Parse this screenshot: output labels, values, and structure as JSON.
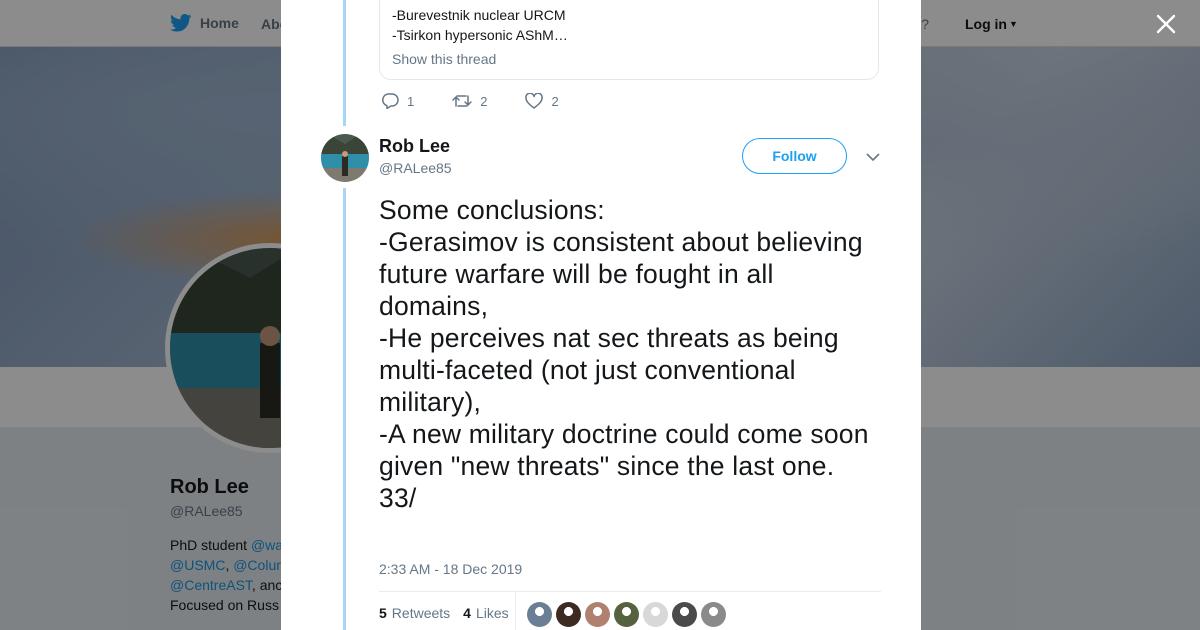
{
  "topnav": {
    "home_label": "Home",
    "about_label": "Abo",
    "account_prompt": "ccount?",
    "login_label": "Log in"
  },
  "profile": {
    "name": "Rob Lee",
    "handle": "@RALee85",
    "bio_line1_prefix": "PhD student ",
    "bio_line1_link": "@wa",
    "bio_line2_link1": "@USMC",
    "bio_line2_sep": ", ",
    "bio_line2_link2": "@Colur",
    "bio_line3_link": "@CentreAST",
    "bio_line3_suffix": ", anc",
    "bio_line4": "Focused on Russ"
  },
  "quoted_tweet": {
    "line1": "-Burevestnik nuclear URCM",
    "line2": "-Tsirkon hypersonic AShM…",
    "show_thread": "Show this thread"
  },
  "prev_actions": {
    "replies": "1",
    "retweets": "2",
    "likes": "2"
  },
  "tweet": {
    "author_name": "Rob Lee",
    "author_handle": "@RALee85",
    "follow_label": "Follow",
    "text": "Some conclusions:\n-Gerasimov is consistent about believing future warfare will be fought in all domains,\n-He perceives nat sec threats as being multi-faceted (not just conventional military),\n-A new military doctrine could come soon given \"new threats\" since the last one.\n33/",
    "timestamp": "2:33 AM - 18 Dec 2019",
    "retweet_count": "5",
    "retweet_label": "Retweets",
    "like_count": "4",
    "like_label": "Likes"
  },
  "likers": [
    {
      "name": "liker-avatar-1",
      "color": "#6a7f96"
    },
    {
      "name": "liker-avatar-2",
      "color": "#3d2b22"
    },
    {
      "name": "liker-avatar-3",
      "color": "#b08070"
    },
    {
      "name": "liker-avatar-4",
      "color": "#55613f"
    },
    {
      "name": "liker-avatar-5",
      "color": "#d8d8d8"
    },
    {
      "name": "liker-avatar-6",
      "color": "#4a4a4a"
    },
    {
      "name": "liker-avatar-7",
      "color": "#8a8a8a"
    }
  ],
  "colors": {
    "accent": "#1da1f2",
    "thread_line": "#a8d5f5",
    "text_primary": "#14171a",
    "text_secondary": "#657786"
  },
  "icons": {
    "twitter_logo": "bird-icon",
    "close": "close-icon",
    "reply": "reply-icon",
    "retweet": "retweet-icon",
    "like": "heart-icon",
    "caret": "chevron-down-icon"
  }
}
